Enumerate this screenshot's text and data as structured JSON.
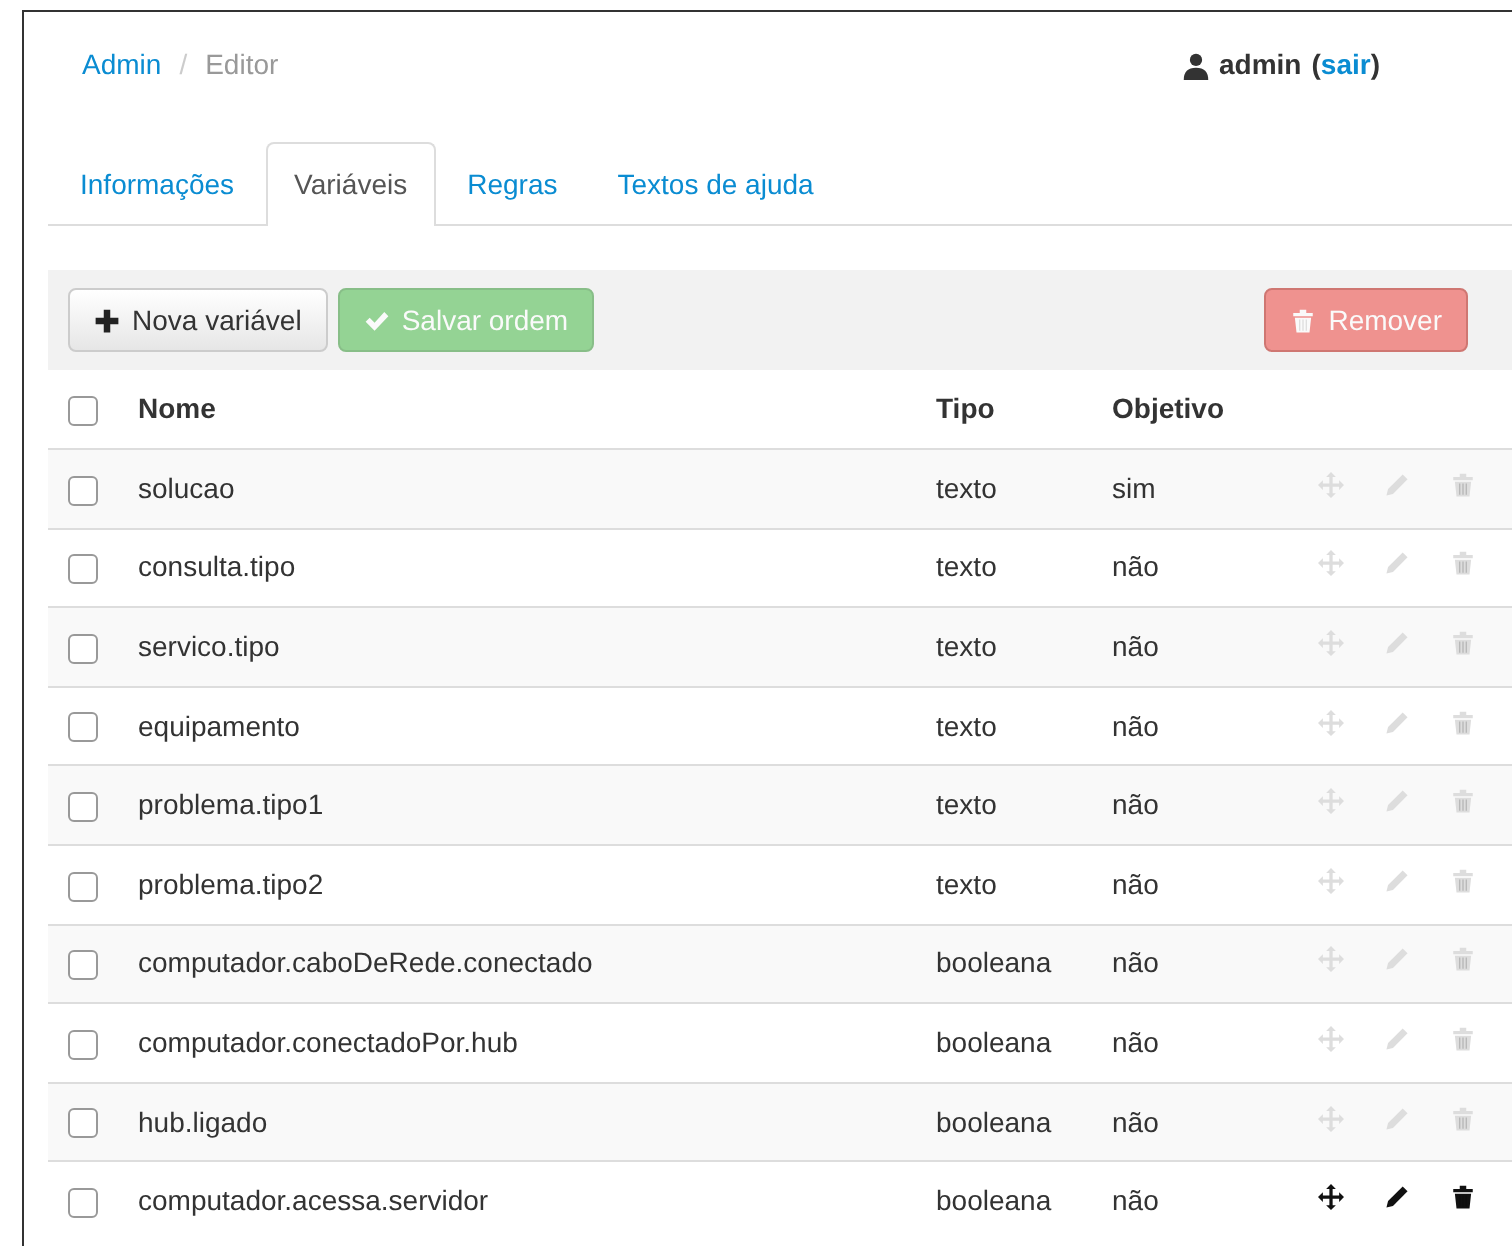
{
  "breadcrumb": [
    {
      "label": "Admin",
      "kind": "link"
    },
    {
      "label": "/",
      "kind": "separator"
    },
    {
      "label": "Editor",
      "kind": "current"
    }
  ],
  "user": {
    "name": "admin",
    "open": "(",
    "logout": "sair",
    "close": ")"
  },
  "tabs": [
    {
      "label": "Informações",
      "selected": false
    },
    {
      "label": "Variáveis",
      "selected": true
    },
    {
      "label": "Regras",
      "selected": false
    },
    {
      "label": "Textos de ajuda",
      "selected": false
    }
  ],
  "toolbar": {
    "buttons": [
      {
        "label": "Nova variável",
        "kind": "new",
        "disabled": false
      },
      {
        "label": "Salvar ordem",
        "kind": "save",
        "disabled": true
      },
      {
        "label": "Remover",
        "kind": "remove",
        "disabled": true
      }
    ]
  },
  "table": {
    "columns": [
      "Nome",
      "Tipo",
      "Objetivo"
    ],
    "header_checked": false,
    "rows": [
      {
        "name": "solucao",
        "type": "texto",
        "goal": "sim",
        "checked": false,
        "hovered": false
      },
      {
        "name": "consulta.tipo",
        "type": "texto",
        "goal": "não",
        "checked": false,
        "hovered": false
      },
      {
        "name": "servico.tipo",
        "type": "texto",
        "goal": "não",
        "checked": false,
        "hovered": false
      },
      {
        "name": "equipamento",
        "type": "texto",
        "goal": "não",
        "checked": false,
        "hovered": false
      },
      {
        "name": "problema.tipo1",
        "type": "texto",
        "goal": "não",
        "checked": false,
        "hovered": false
      },
      {
        "name": "problema.tipo2",
        "type": "texto",
        "goal": "não",
        "checked": false,
        "hovered": false
      },
      {
        "name": "computador.caboDeRede.conectado",
        "type": "booleana",
        "goal": "não",
        "checked": false,
        "hovered": false
      },
      {
        "name": "computador.conectadoPor.hub",
        "type": "booleana",
        "goal": "não",
        "checked": false,
        "hovered": false
      },
      {
        "name": "hub.ligado",
        "type": "booleana",
        "goal": "não",
        "checked": false,
        "hovered": false
      },
      {
        "name": "computador.acessa.servidor",
        "type": "booleana",
        "goal": "não",
        "checked": false,
        "hovered": true
      }
    ]
  }
}
